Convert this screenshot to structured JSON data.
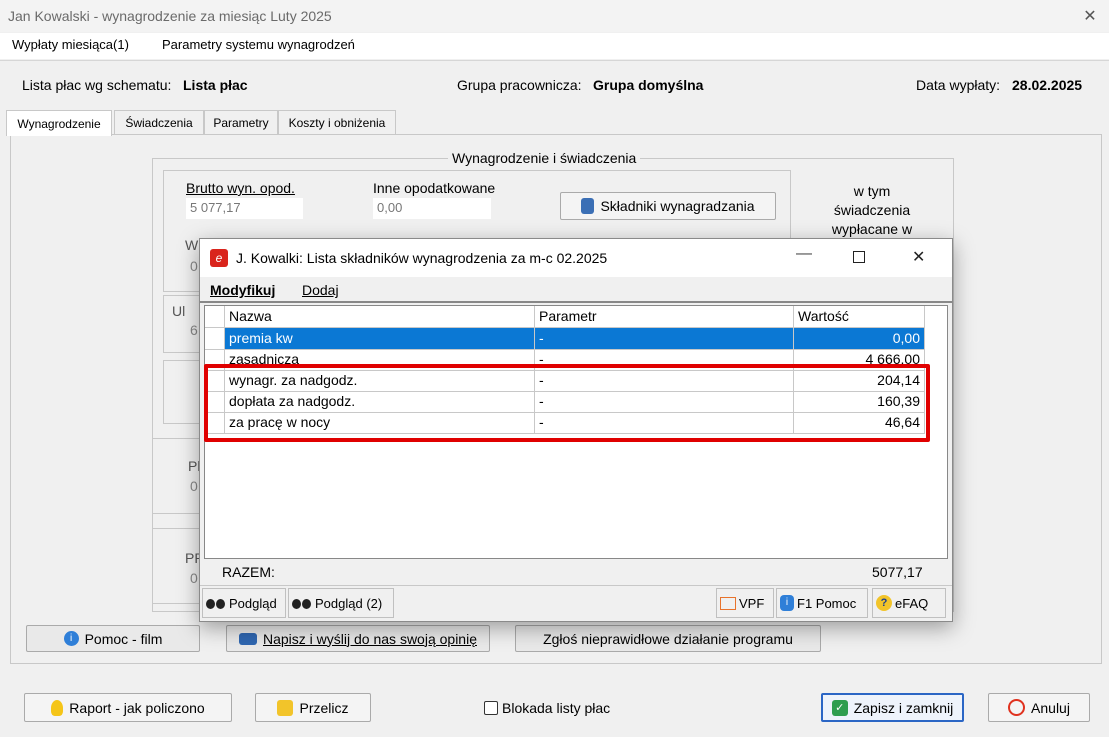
{
  "window": {
    "title": "Jan Kowalski - wynagrodzenie za miesiąc Luty 2025"
  },
  "menu": [
    "Wypłaty miesiąca(1)",
    "Parametry systemu wynagrodzeń"
  ],
  "header": {
    "schema_label": "Lista płac wg schematu:",
    "schema_value": "Lista płac",
    "group_label": "Grupa pracownicza:",
    "group_value": "Grupa domyślna",
    "date_label": "Data wypłaty:",
    "date_value": "28.02.2025"
  },
  "tabs": [
    "Wynagrodzenie",
    "Świadczenia",
    "Parametry",
    "Koszty i obniżenia"
  ],
  "main": {
    "group_title": "Wynagrodzenie i świadczenia",
    "brutto_label": "Brutto wyn. opod.",
    "brutto_value": "5 077,17",
    "inne_label": "Inne opodatkowane",
    "inne_value": "0,00",
    "skladniki_button": "Składniki wynagradzania",
    "w_tym_1": "w tym",
    "w_tym_2": "świadczenia",
    "w_tym_3": "wypłacane w",
    "frag_w": "W",
    "frag_0a": "0",
    "frag_ul": "Ul",
    "frag_6": "6",
    "frag_pl": "Pl",
    "frag_0b": "0",
    "frag_pp": "PP",
    "frag_0c": "0"
  },
  "bottom_buttons": {
    "pomoc_film": "Pomoc - film",
    "napisz": "Napisz i wyślij do nas swoją opinię",
    "zglos": "Zgłoś nieprawidłowe działanie programu"
  },
  "footer": {
    "raport": "Raport - jak policzono",
    "przelicz": "Przelicz",
    "blokada": "Blokada listy płac",
    "zapisz": "Zapisz i zamknij",
    "anuluj": "Anuluj"
  },
  "dialog": {
    "title": "J. Kowalki: Lista składników wynagrodzenia za m-c 02.2025",
    "menu": [
      "Modyfikuj",
      "Dodaj"
    ],
    "columns": [
      "Nazwa",
      "Parametr",
      "Wartość"
    ],
    "rows": [
      {
        "name": "premia kw",
        "param": "-",
        "value": "0,00"
      },
      {
        "name": "zasadnicza",
        "param": "-",
        "value": "4 666,00"
      },
      {
        "name": "wynagr. za nadgodz.",
        "param": "-",
        "value": "204,14"
      },
      {
        "name": "dopłata za nadgodz.",
        "param": "-",
        "value": "160,39"
      },
      {
        "name": "za pracę w nocy",
        "param": "-",
        "value": "46,64"
      }
    ],
    "sum_label": "RAZEM:",
    "sum_value": "5077,17",
    "footer_buttons": [
      "Podgląd",
      "Podgląd (2)",
      "VPF",
      "F1 Pomoc",
      "eFAQ"
    ]
  },
  "colors": {
    "selection": "#0b78d4",
    "highlight": "#e00000",
    "accent_green": "#2e9e4f"
  }
}
